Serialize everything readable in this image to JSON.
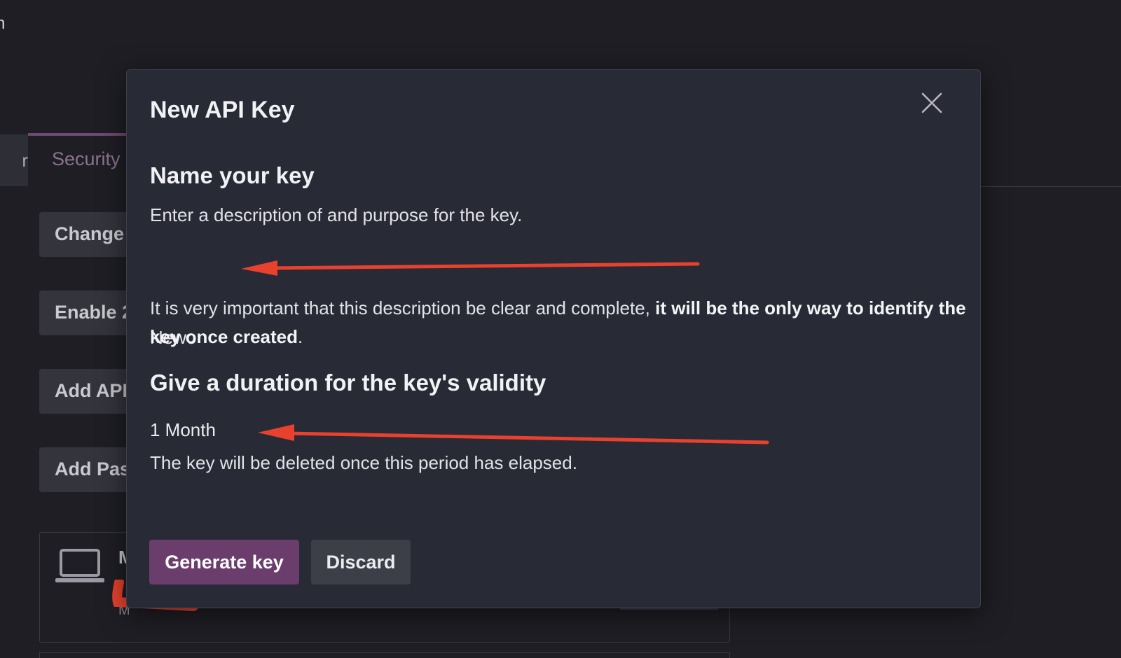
{
  "background": {
    "title_fragment": "n",
    "tabs": [
      {
        "label": "r"
      },
      {
        "label": "Security"
      }
    ],
    "buttons": [
      {
        "label": "Change"
      },
      {
        "label": "Enable 2"
      },
      {
        "label": "Add API"
      },
      {
        "label": "Add Pas"
      }
    ],
    "device": {
      "name_fragment": "M",
      "sub_fragment": "M"
    }
  },
  "modal": {
    "title": "New API Key",
    "close_icon": "close-icon",
    "name_section": {
      "title": "Name your key",
      "description": "Enter a description of and purpose for the key.",
      "input_value": "Newo",
      "warning_prefix": "It is very important that this description be clear and complete, ",
      "warning_bold": "it will be the only way to identify the key once created",
      "warning_suffix": "."
    },
    "duration_section": {
      "title": "Give a duration for the key's validity",
      "selected_value": "1 Month",
      "note": "The key will be deleted once this period has elapsed."
    },
    "actions": {
      "generate_label": "Generate key",
      "discard_label": "Discard"
    }
  },
  "colors": {
    "primary": "#6a3d6d",
    "annotation": "#e8412e",
    "modal_bg": "#282a36",
    "page_bg": "#1e1e24"
  }
}
